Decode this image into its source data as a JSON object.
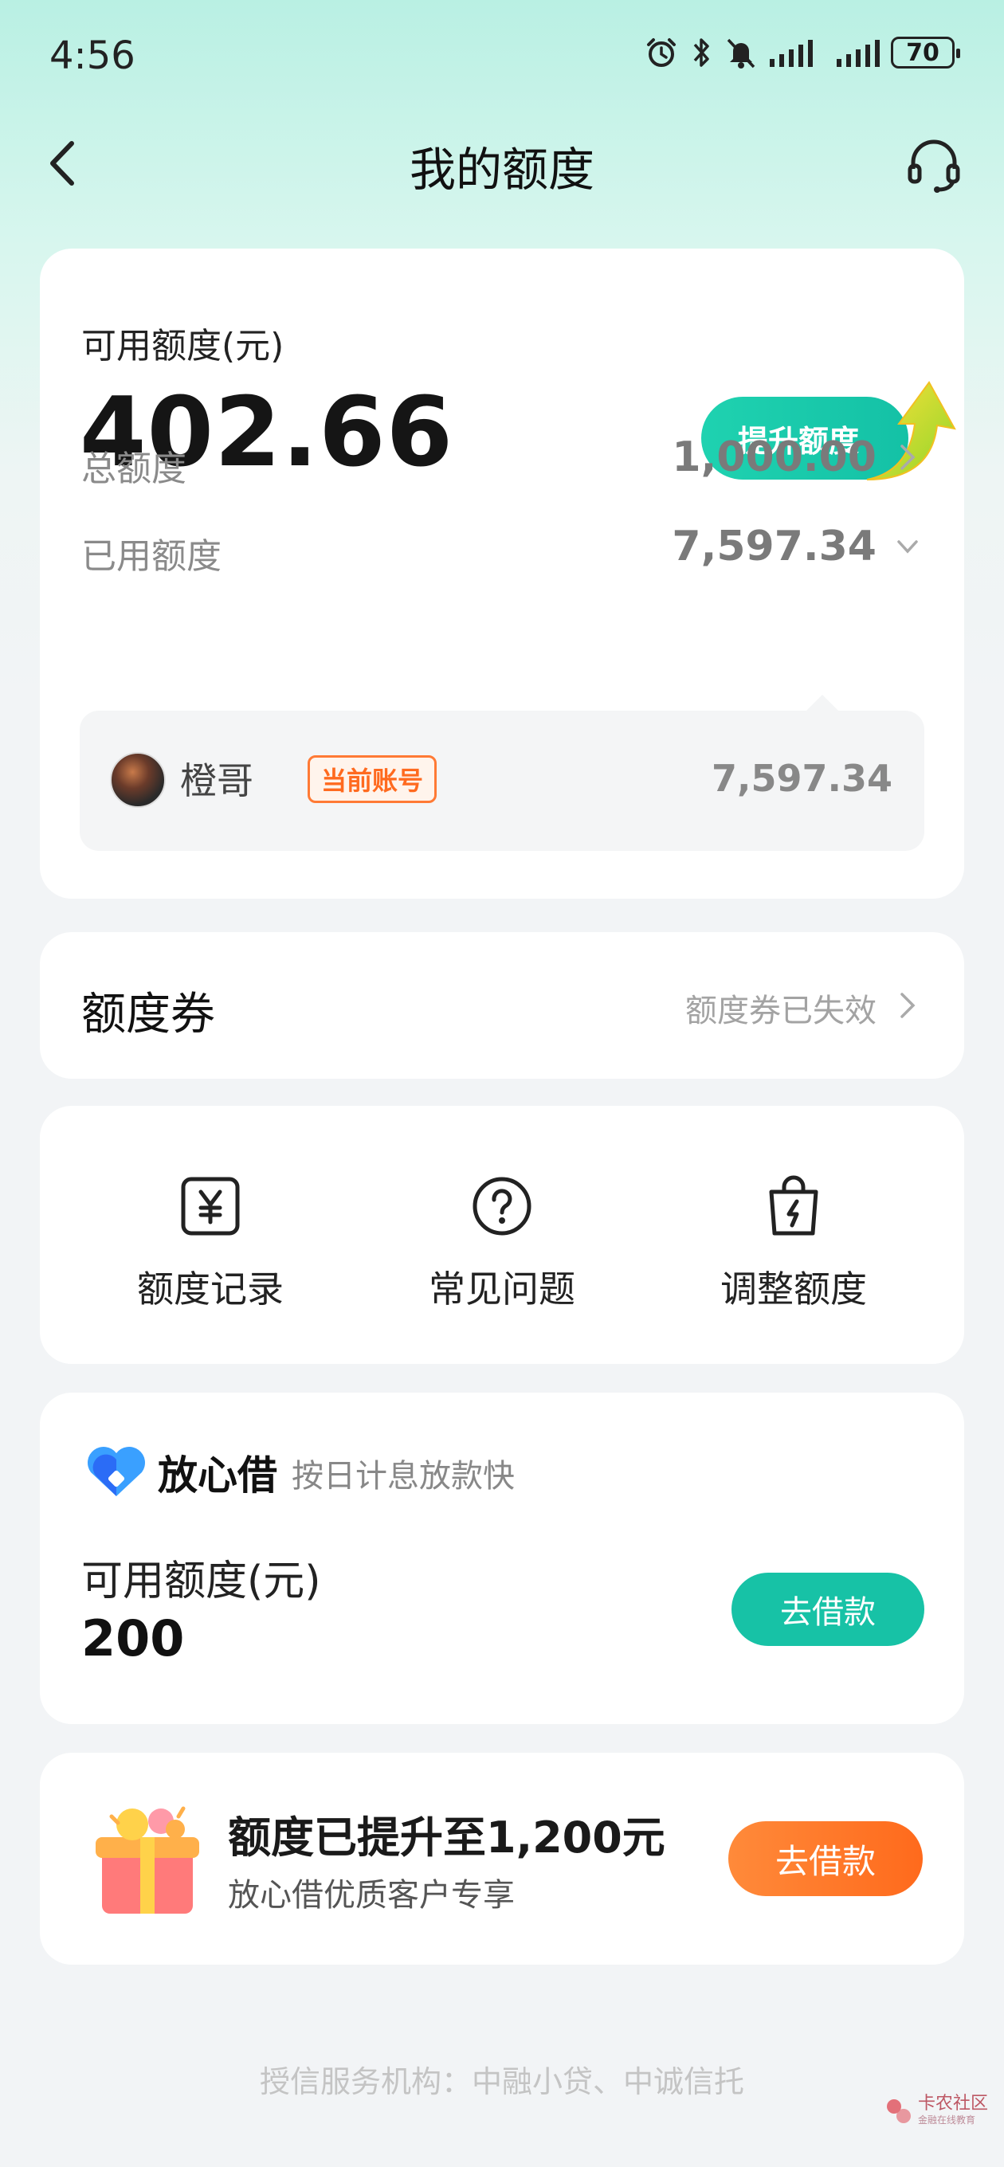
{
  "status_bar": {
    "time": "4:56",
    "battery": "70"
  },
  "nav": {
    "title": "我的额度"
  },
  "quota": {
    "available_label": "可用额度(元)",
    "available_amount": "402.66",
    "raise_button": "提升额度",
    "total_label": "总额度",
    "total_value": "1,000.00",
    "used_label": "已用额度",
    "used_value": "7,597.34",
    "account": {
      "name": "橙哥",
      "badge": "当前账号",
      "amount": "7,597.34"
    }
  },
  "coupon": {
    "title": "额度券",
    "status": "额度券已失效"
  },
  "actions": [
    {
      "label": "额度记录",
      "icon": "yuan-receipt-icon"
    },
    {
      "label": "常见问题",
      "icon": "question-circle-icon"
    },
    {
      "label": "调整额度",
      "icon": "bag-lightning-icon"
    }
  ],
  "loan": {
    "brand": "放心借",
    "slogan": "按日计息放款快",
    "available_label": "可用额度(元)",
    "available_amount": "200",
    "button": "去借款"
  },
  "promo": {
    "title": "额度已提升至1,200元",
    "subtitle": "放心借优质客户专享",
    "button": "去借款"
  },
  "footer": {
    "text": "授信服务机构：中融小贷、中诚信托"
  },
  "watermark": {
    "text": "卡农社区",
    "sub": "金融在线教育"
  },
  "colors": {
    "accent_green": "#17c2a6",
    "accent_orange": "#ff6a1c",
    "badge_orange": "#ff7a35"
  }
}
